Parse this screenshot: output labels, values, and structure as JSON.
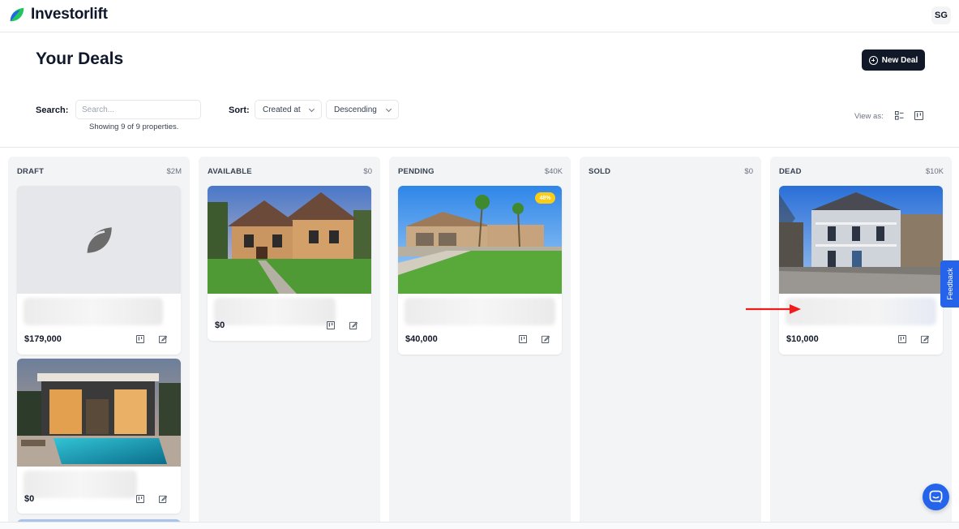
{
  "app": {
    "name": "Investorlift",
    "user_initials": "SG",
    "brand_green": "#22c55e",
    "brand_blue": "#2563eb"
  },
  "header": {
    "title": "Your Deals",
    "new_deal_label": "New Deal"
  },
  "filters": {
    "search_label": "Search:",
    "search_placeholder": "Search...",
    "search_value": "",
    "showing_text": "Showing 9 of 9 properties.",
    "sort_label": "Sort:",
    "sort_field": "Created at",
    "sort_direction": "Descending",
    "view_as_label": "View as:",
    "view_icons": [
      "list-view-icon",
      "board-view-icon"
    ]
  },
  "columns": [
    {
      "title": "DRAFT",
      "total": "$2M",
      "cards": [
        {
          "price": "$179,000",
          "image": "placeholder-logo"
        },
        {
          "price": "$0",
          "image": "modern-house-pool"
        }
      ]
    },
    {
      "title": "AVAILABLE",
      "total": "$0",
      "cards": [
        {
          "price": "$0",
          "image": "stone-house-lawn"
        }
      ]
    },
    {
      "title": "PENDING",
      "total": "$40K",
      "cards": [
        {
          "price": "$40,000",
          "image": "desert-house-palm",
          "badge": "48%"
        }
      ]
    },
    {
      "title": "SOLD",
      "total": "$0",
      "cards": []
    },
    {
      "title": "DEAD",
      "total": "$10K",
      "cards": [
        {
          "price": "$10,000",
          "image": "victorian-house-winter"
        }
      ]
    }
  ],
  "widgets": {
    "feedback_label": "Feedback",
    "chat_icon": "chat-bubble-icon"
  }
}
